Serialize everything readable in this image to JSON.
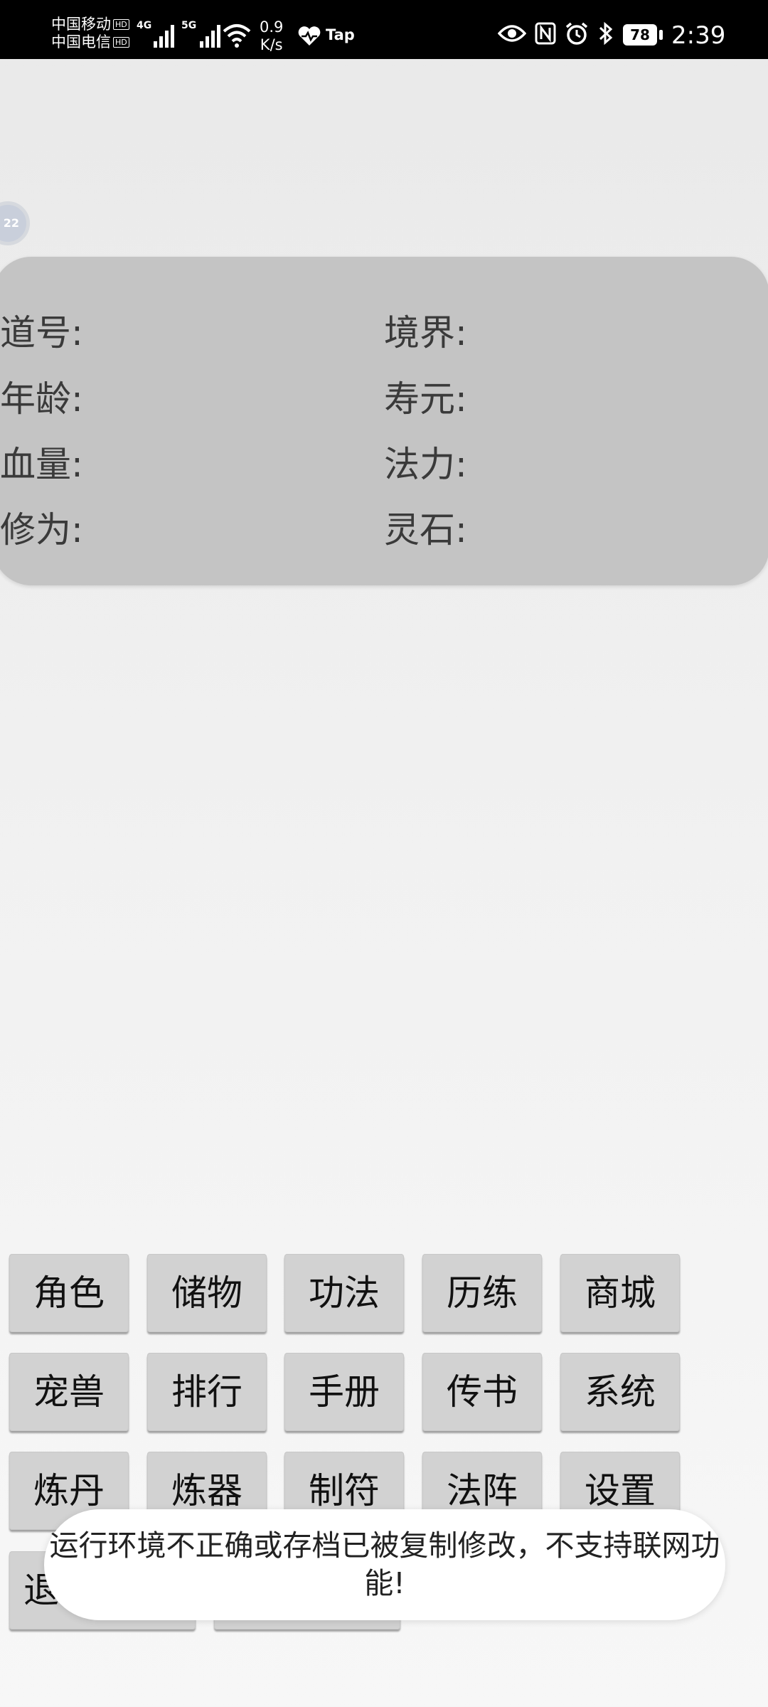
{
  "status_bar": {
    "carrier_1": "中国移动",
    "carrier_2": "中国电信",
    "hd_badge": "HD",
    "sim1_generation": "4G",
    "sim2_generation": "5G",
    "net_speed_value": "0.9",
    "net_speed_unit": "K/s",
    "tap_label": "Tap",
    "battery_level": "78",
    "time": "2:39"
  },
  "float_ball": {
    "label": "22"
  },
  "info_panel": {
    "daohao_label": "道号:",
    "jingjie_label": "境界:",
    "nianling_label": "年龄:",
    "shouyuan_label": "寿元:",
    "xueliang_label": "血量:",
    "fali_label": "法力:",
    "xiuwei_label": "修为:",
    "lingshi_label": "灵石:"
  },
  "menu": {
    "row1": [
      "角色",
      "储物",
      "功法",
      "历练",
      "商城"
    ],
    "row2": [
      "宠兽",
      "排行",
      "手册",
      "传书",
      "系统"
    ],
    "row3": [
      "炼丹",
      "炼器",
      "制符",
      "法阵",
      "设置"
    ],
    "row4_first_visible": "退"
  },
  "toast": {
    "message": "运行环境不正确或存档已被复制修改，不支持联网功能!"
  },
  "colors": {
    "panel_bg": "#c4c4c4",
    "button_bg": "#d2d2d2",
    "toast_bg": "#ffffff",
    "status_bar_bg": "#000000"
  }
}
